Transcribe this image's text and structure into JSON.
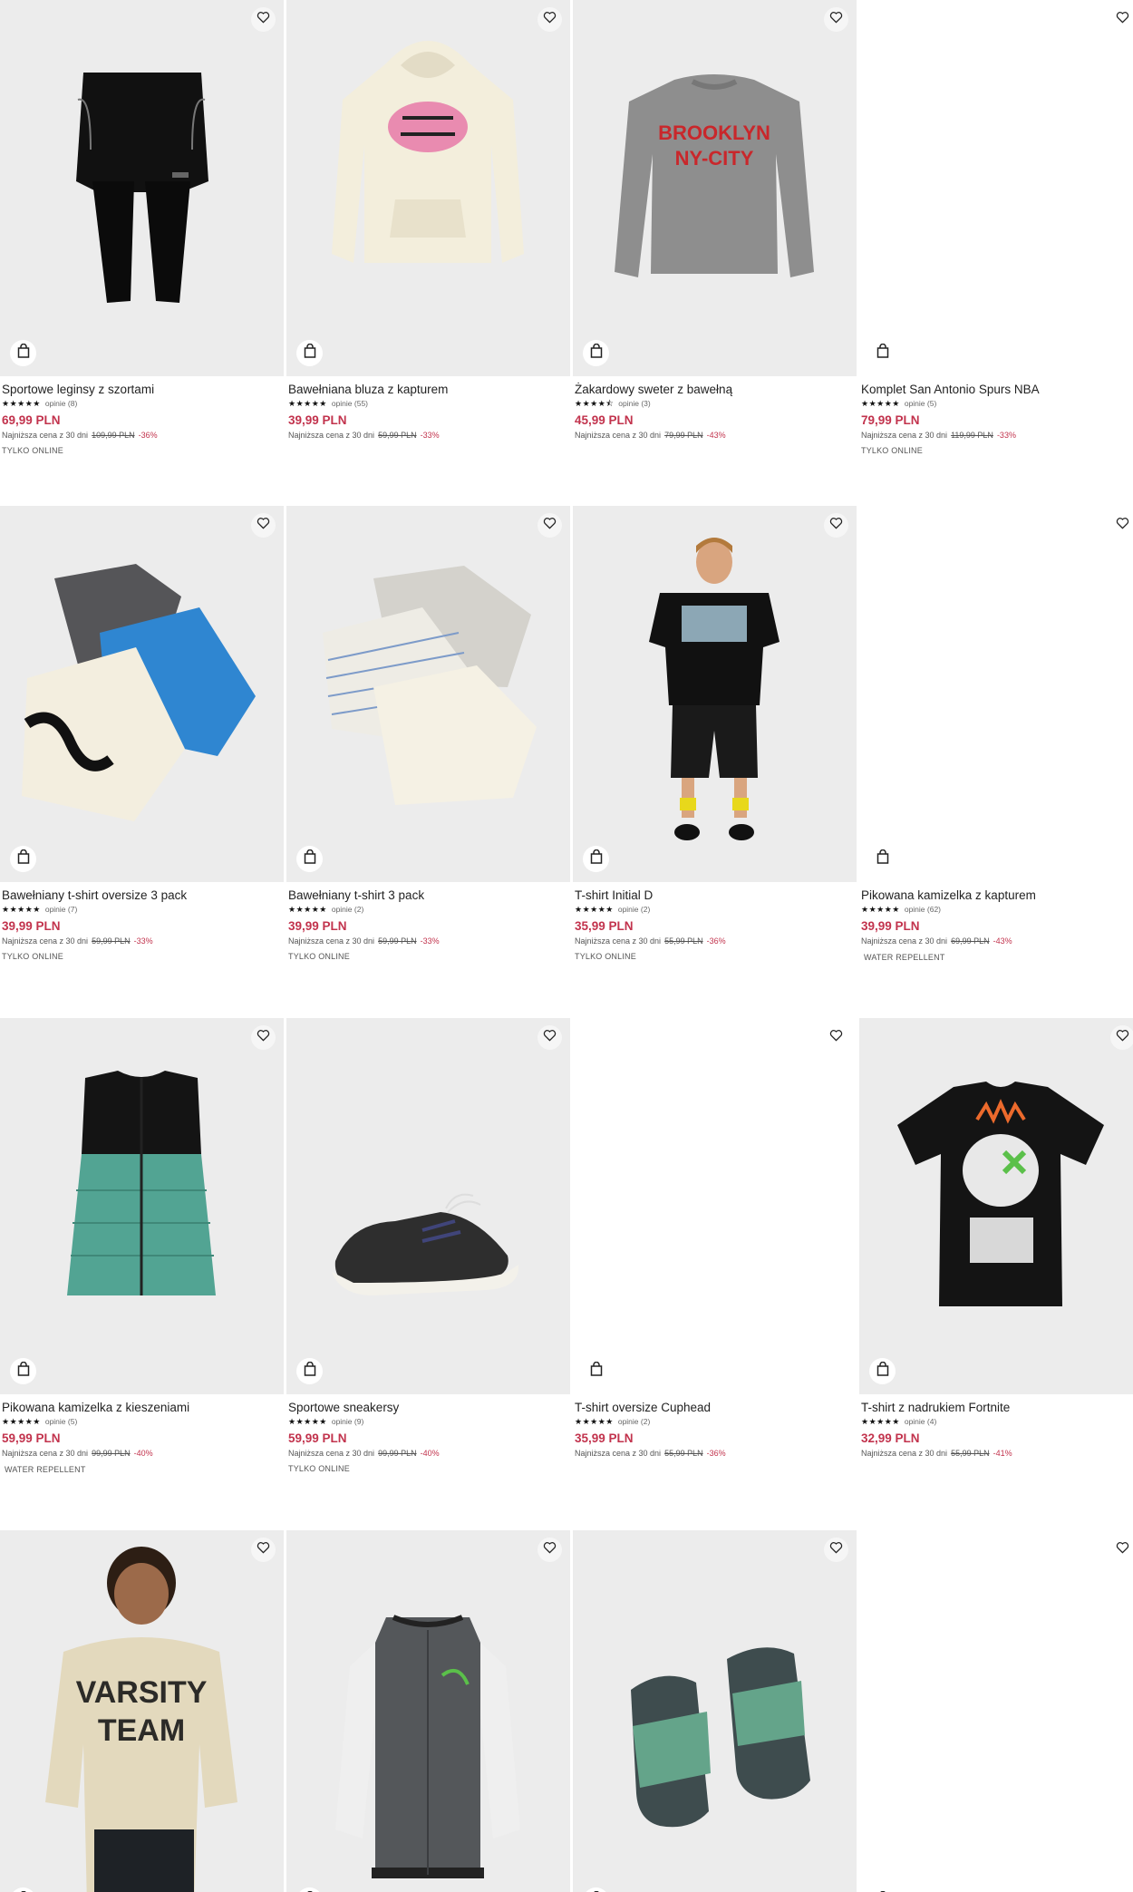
{
  "colors": {
    "price": "#c2334d",
    "image_bg": "#ececec"
  },
  "icons": {
    "favorite": "heart-outline-icon",
    "cart": "shopping-bag-icon",
    "rating": "star-icon"
  },
  "lowest_price_label": "Najniższa cena z 30 dni",
  "products": [
    {
      "name": "Sportowe leginsy z szortami",
      "stars": "★★★★★",
      "reviews": "opinie (8)",
      "price": "69,99 PLN",
      "old_price": "109,99 PLN",
      "discount": "-36%",
      "badge": "TYLKO ONLINE"
    },
    {
      "name": "Bawełniana bluza z kapturem",
      "stars": "★★★★★",
      "reviews": "opinie (55)",
      "price": "39,99 PLN",
      "old_price": "59,99 PLN",
      "discount": "-33%",
      "badge": ""
    },
    {
      "name": "Żakardowy sweter z bawełną",
      "stars": "★★★★⯪",
      "reviews": "opinie (3)",
      "price": "45,99 PLN",
      "old_price": "79,99 PLN",
      "discount": "-43%",
      "badge": "",
      "print": "BROOKLYN\nNY-CITY"
    },
    {
      "name": "Komplet San Antonio Spurs NBA",
      "stars": "★★★★★",
      "reviews": "opinie (5)",
      "price": "79,99 PLN",
      "old_price": "119,99 PLN",
      "discount": "-33%",
      "badge": "TYLKO ONLINE"
    },
    {
      "name": "Bawełniany t-shirt oversize 3 pack",
      "stars": "★★★★★",
      "reviews": "opinie (7)",
      "price": "39,99 PLN",
      "old_price": "59,99 PLN",
      "discount": "-33%",
      "badge": "TYLKO ONLINE"
    },
    {
      "name": "Bawełniany t-shirt 3 pack",
      "stars": "★★★★★",
      "reviews": "opinie (2)",
      "price": "39,99 PLN",
      "old_price": "59,99 PLN",
      "discount": "-33%",
      "badge": "TYLKO ONLINE"
    },
    {
      "name": "T-shirt Initial D",
      "stars": "★★★★★",
      "reviews": "opinie (2)",
      "price": "35,99 PLN",
      "old_price": "55,99 PLN",
      "discount": "-36%",
      "badge": "TYLKO ONLINE"
    },
    {
      "name": "Pikowana kamizelka z kapturem",
      "stars": "★★★★★",
      "reviews": "opinie (62)",
      "price": "39,99 PLN",
      "old_price": "69,99 PLN",
      "discount": "-43%",
      "badge": "WATER REPELLENT"
    },
    {
      "name": "Pikowana kamizelka z kieszeniami",
      "stars": "★★★★★",
      "reviews": "opinie (5)",
      "price": "59,99 PLN",
      "old_price": "99,99 PLN",
      "discount": "-40%",
      "badge": "WATER REPELLENT"
    },
    {
      "name": "Sportowe sneakersy",
      "stars": "★★★★★",
      "reviews": "opinie (9)",
      "price": "59,99 PLN",
      "old_price": "99,99 PLN",
      "discount": "-40%",
      "badge": "TYLKO ONLINE"
    },
    {
      "name": "T-shirt oversize Cuphead",
      "stars": "★★★★★",
      "reviews": "opinie (2)",
      "price": "35,99 PLN",
      "old_price": "55,99 PLN",
      "discount": "-36%",
      "badge": ""
    },
    {
      "name": "T-shirt z nadrukiem Fortnite",
      "stars": "★★★★★",
      "reviews": "opinie (4)",
      "price": "32,99 PLN",
      "old_price": "55,99 PLN",
      "discount": "-41%",
      "badge": ""
    },
    {
      "name": "",
      "stars": "",
      "reviews": "",
      "price": "",
      "old_price": "",
      "discount": "",
      "badge": "",
      "print": "VARSITY\nTEAM"
    },
    {
      "name": "",
      "stars": "",
      "reviews": "",
      "price": "",
      "old_price": "",
      "discount": "",
      "badge": ""
    },
    {
      "name": "",
      "stars": "",
      "reviews": "",
      "price": "",
      "old_price": "",
      "discount": "",
      "badge": ""
    },
    {
      "name": "",
      "stars": "",
      "reviews": "",
      "price": "",
      "old_price": "",
      "discount": "",
      "badge": ""
    }
  ]
}
